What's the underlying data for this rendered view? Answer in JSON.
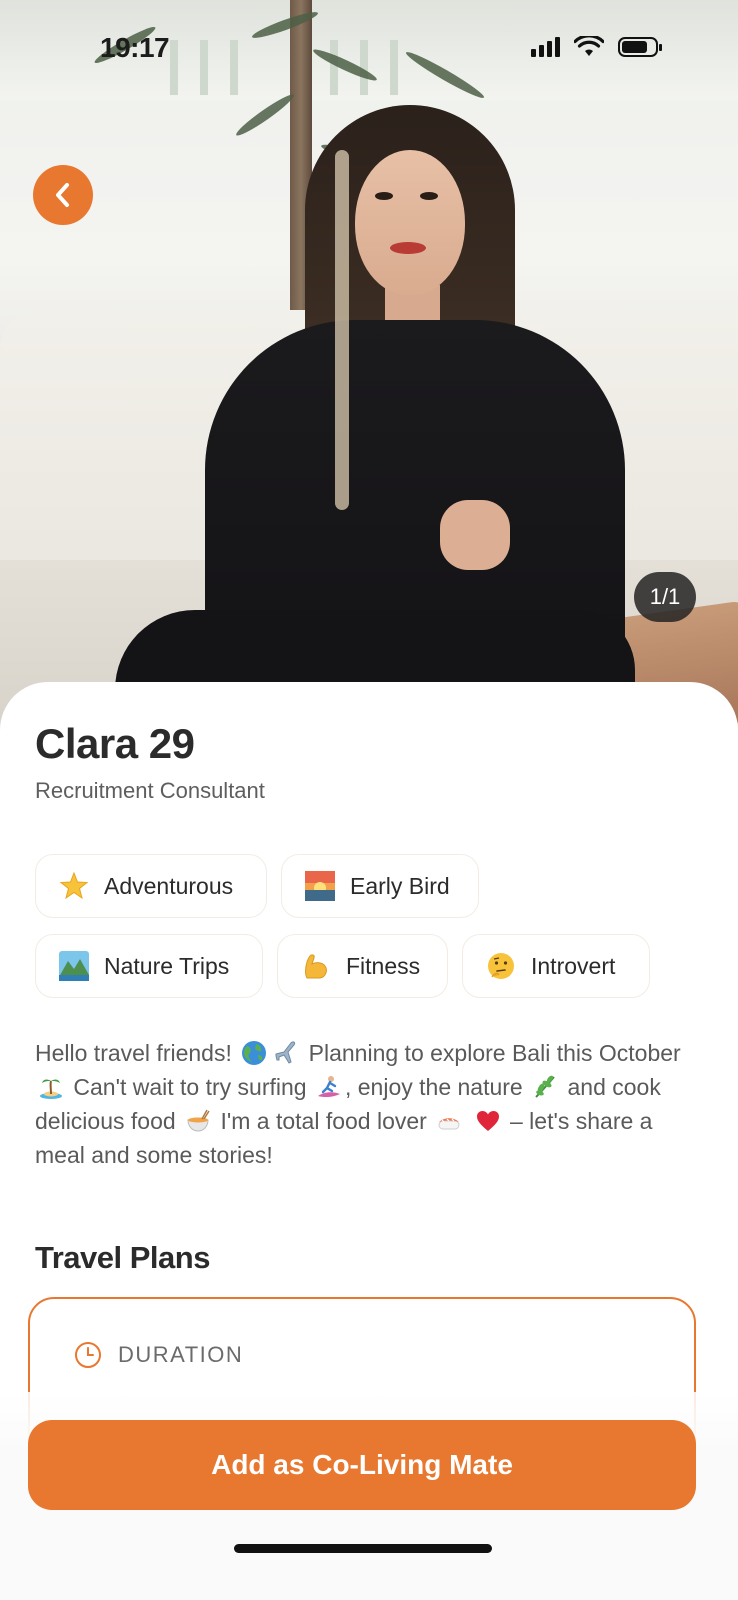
{
  "status_bar": {
    "time": "19:17"
  },
  "photo": {
    "counter": "1/1"
  },
  "profile": {
    "name": "Clara 29",
    "occupation": "Recruitment Consultant"
  },
  "traits": [
    {
      "label": "Adventurous",
      "icon": "star-icon"
    },
    {
      "label": "Early Bird",
      "icon": "sunrise-icon"
    },
    {
      "label": "Nature Trips",
      "icon": "mountain-landscape-icon"
    },
    {
      "label": "Fitness",
      "icon": "flexed-bicep-icon"
    },
    {
      "label": "Introvert",
      "icon": "thinking-face-icon"
    }
  ],
  "bio": {
    "p1": "Hello travel friends!",
    "p2": "Planning to explore Bali this October",
    "p3": "Can't wait to try surfing",
    "p4": ", enjoy the nature",
    "p5": "and cook delicious food",
    "p6": "I'm a total food lover",
    "p7": "– let's share a meal and some stories!"
  },
  "travel_plans": {
    "title": "Travel Plans",
    "duration_label": "DURATION"
  },
  "cta": {
    "label": "Add as Co-Living Mate"
  },
  "colors": {
    "accent": "#e8782f"
  }
}
